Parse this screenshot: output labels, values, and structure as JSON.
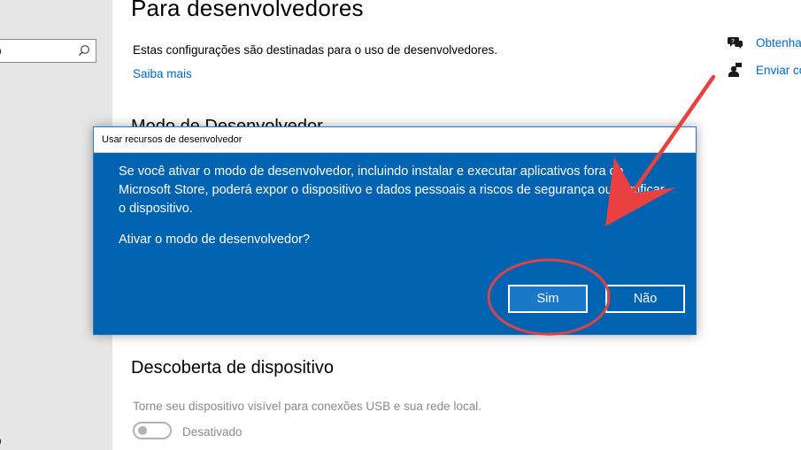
{
  "nav": {
    "stub_top": "o",
    "stub_bottom": "o"
  },
  "main": {
    "title": "Para desenvolvedores",
    "description": "Estas configurações são destinadas para o uso de desenvolvedores.",
    "learn_more": "Saiba mais",
    "hidden_section_title": "Modo de Desenvolvedor",
    "device_discovery": {
      "title": "Descoberta de dispositivo",
      "description": "Torne seu dispositivo visível para conexões USB e sua rede local.",
      "toggle_state": "Desativado",
      "toggle_on": false
    }
  },
  "side_links": [
    {
      "label": "Obtenha",
      "icon": "help-chat-icon"
    },
    {
      "label": "Enviar co",
      "icon": "feedback-person-icon"
    }
  ],
  "dialog": {
    "title": "Usar recursos de desenvolvedor",
    "message": "Se você ativar o modo de desenvolvedor, incluindo instalar e executar aplicativos fora da Microsoft Store, poderá expor o dispositivo e dados pessoais a riscos de segurança ou danificar o dispositivo.",
    "question": "Ativar o modo de desenvolvedor?",
    "yes_label": "Sim",
    "no_label": "Não"
  },
  "colors": {
    "dialog_bg": "#0063b1",
    "link": "#0067c0",
    "annotation": "#e8413f",
    "nav_bg": "#e6e6e6"
  }
}
